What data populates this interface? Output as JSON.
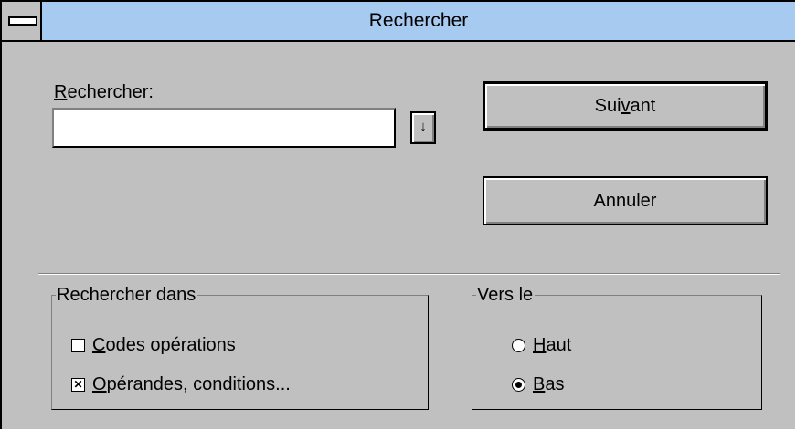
{
  "window": {
    "title": "Rechercher"
  },
  "search": {
    "label_accel": "R",
    "label_rest": "echercher:",
    "value": "",
    "dropdown_glyph": "↓"
  },
  "buttons": {
    "next_pre": "Sui",
    "next_accel": "v",
    "next_post": "ant",
    "cancel": "Annuler"
  },
  "search_in": {
    "title": "Rechercher dans",
    "codes": {
      "accel": "C",
      "rest": "odes opérations",
      "checked": false
    },
    "operands": {
      "accel": "O",
      "rest": "pérandes, conditions...",
      "checked": true,
      "mark": "✕"
    }
  },
  "direction": {
    "title": "Vers le",
    "up": {
      "accel": "H",
      "rest": "aut",
      "selected": false
    },
    "down": {
      "accel": "B",
      "rest": "as",
      "selected": true
    }
  }
}
